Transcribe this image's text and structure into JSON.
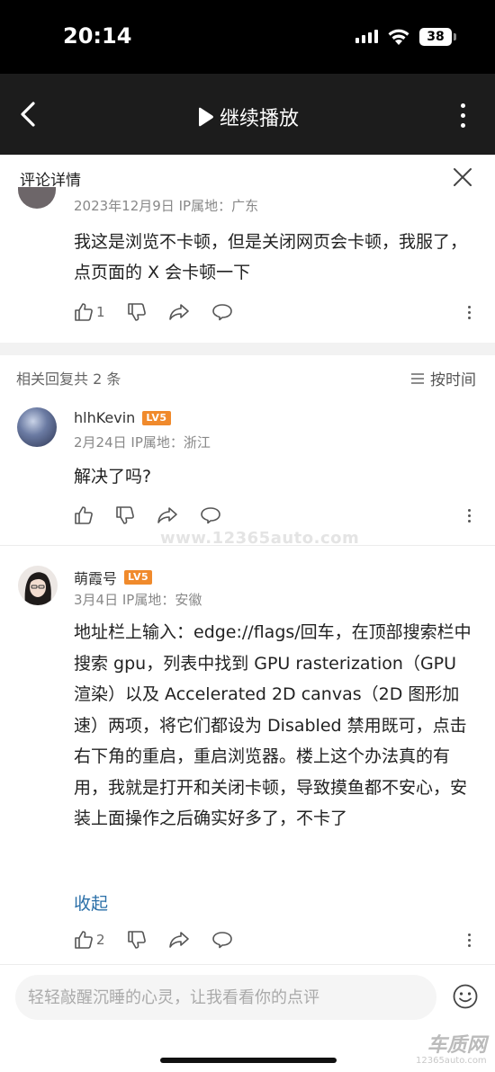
{
  "status": {
    "time": "20:14",
    "battery": "38"
  },
  "video_header": {
    "play_label": "继续播放"
  },
  "sheet": {
    "title": "评论详情"
  },
  "main_comment": {
    "meta_date": "2023年12月9日",
    "meta_ip": "IP属地：广东",
    "text": "我这是浏览不卡顿，但是关闭网页会卡顿，我服了，点页面的 X 会卡顿一下",
    "like_count": "1"
  },
  "replies_header": {
    "count_label": "相关回复共 2 条",
    "sort_label": "按时间"
  },
  "replies": [
    {
      "username": "hlhKevin",
      "level": "LV5",
      "meta_date": "2月24日",
      "meta_ip": "IP属地：浙江",
      "text": "解决了吗?"
    },
    {
      "username": "萌霞号",
      "level": "LV5",
      "meta_date": "3月4日",
      "meta_ip": "IP属地：安徽",
      "text": "地址栏上输入：edge://flags/回车，在顶部搜索栏中搜索 gpu，列表中找到 GPU rasterization（GPU 渲染）以及 Accelerated 2D canvas（2D 图形加速）两项，将它们都设为 Disabled 禁用既可，点击右下角的重启，重启浏览器。楼上这个办法真的有用，我就是打开和关闭卡顿，导致摸鱼都不安心，安装上面操作之后确实好多了，不卡了",
      "collapse_label": "收起",
      "like_count": "2"
    }
  ],
  "watermark": "www.12365auto.com",
  "footer": {
    "placeholder": "轻轻敲醒沉睡的心灵，让我看看你的点评"
  },
  "brand": {
    "main": "车质网",
    "sub": "12365auto.com"
  },
  "colors": {
    "accent_link": "#2a6fa8",
    "level_badge": "#f08a2c"
  }
}
